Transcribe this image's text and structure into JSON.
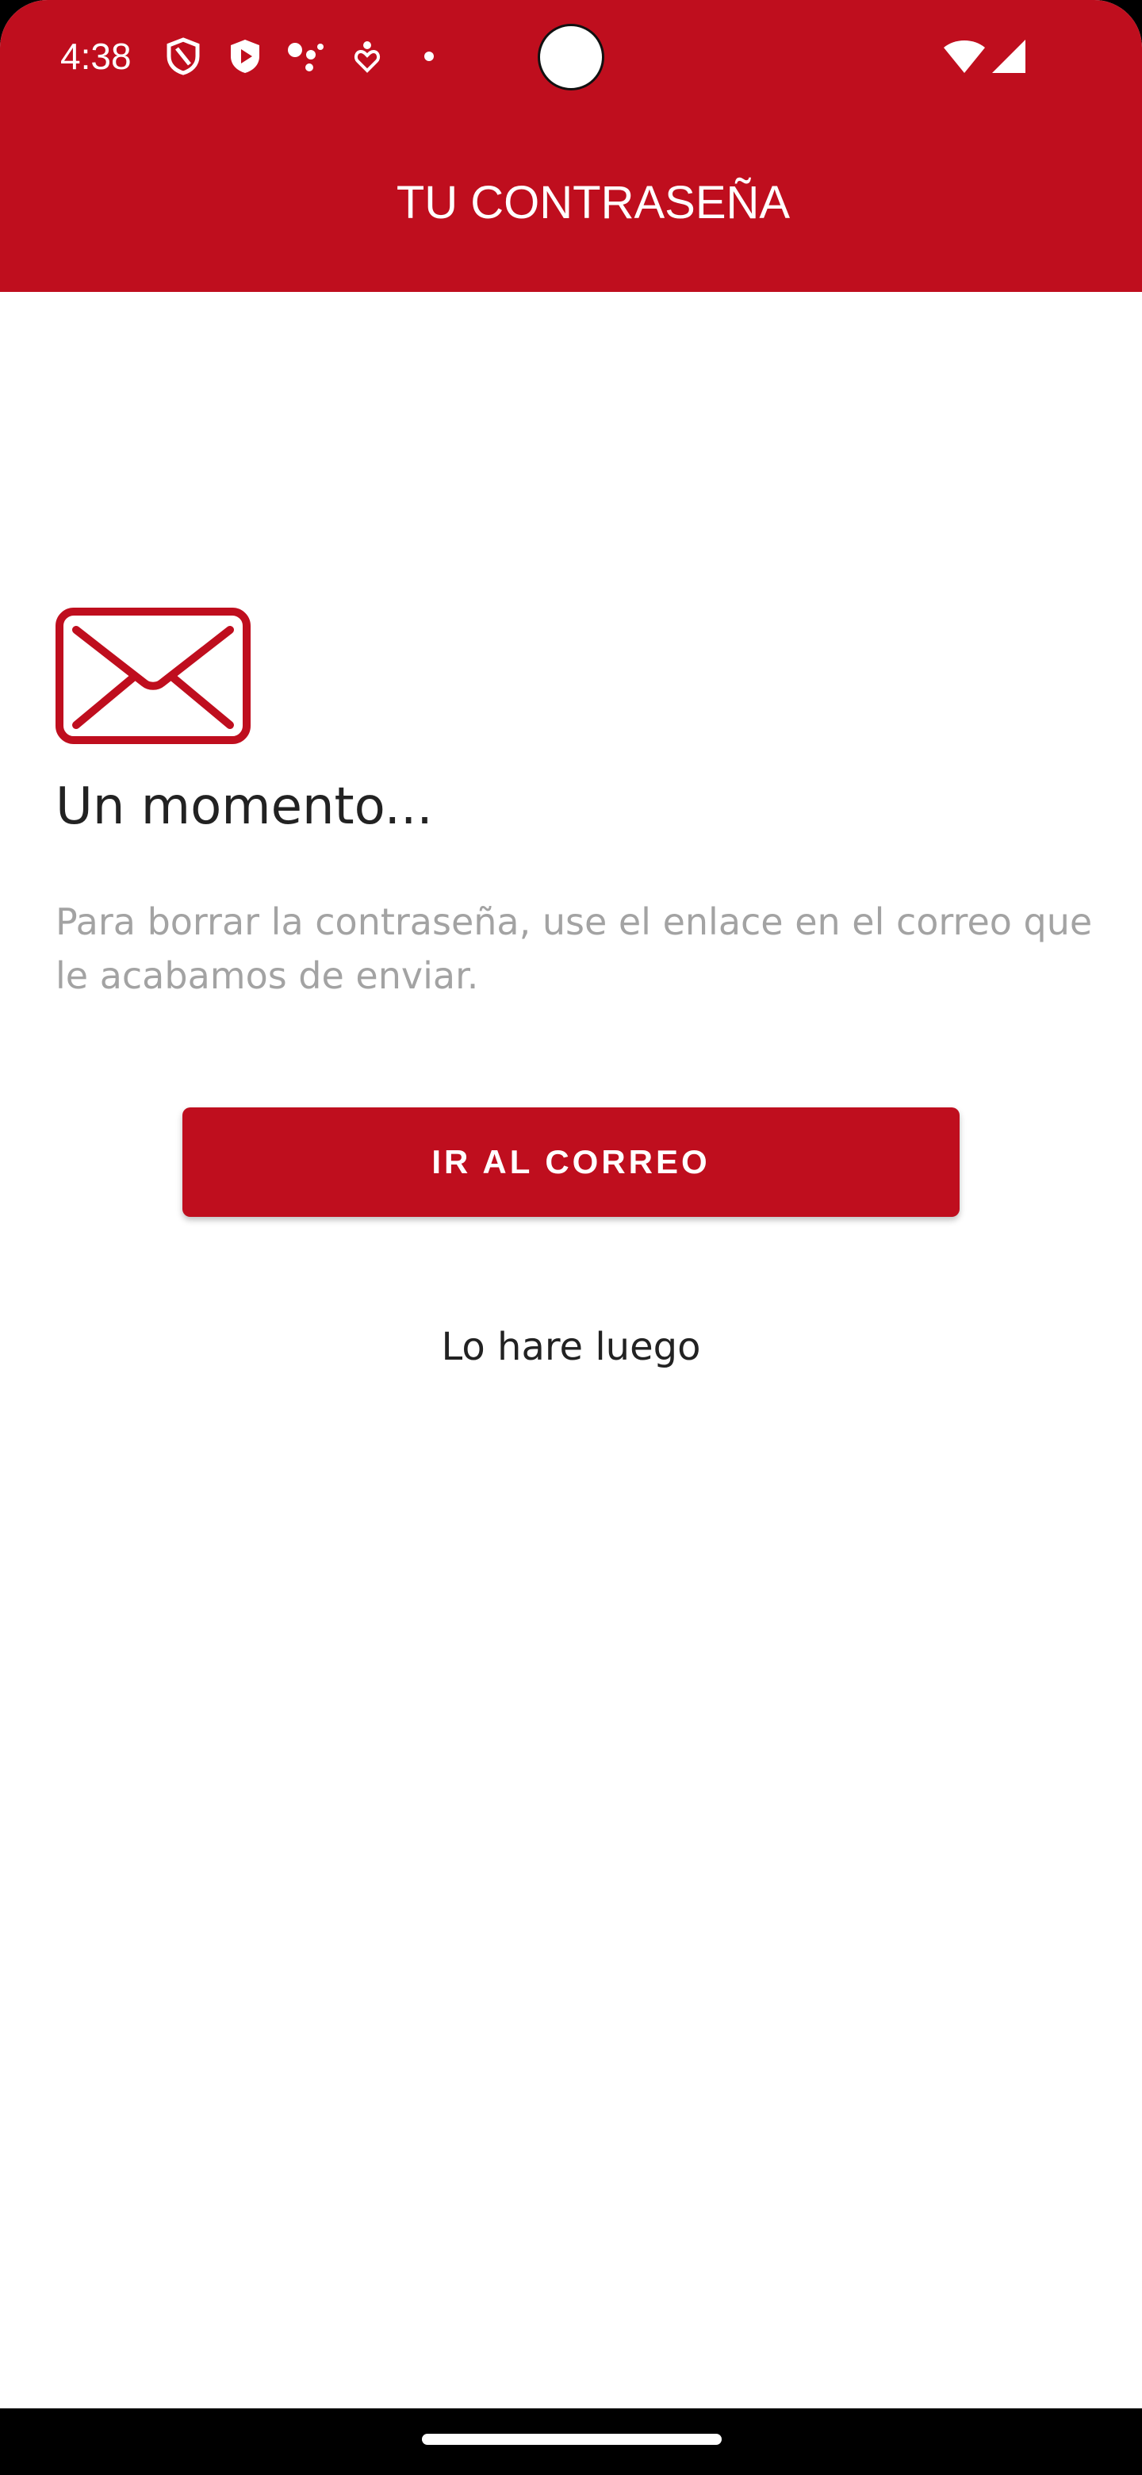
{
  "status_bar": {
    "time": "4:38",
    "icons": [
      "shield-outline-icon",
      "shield-play-icon",
      "dots-cluster-icon",
      "heart-pin-icon",
      "dot-icon",
      "wifi-icon",
      "cellular-signal-icon"
    ]
  },
  "app_bar": {
    "title": "TU CONTRASEÑA"
  },
  "content": {
    "icon": "envelope-icon",
    "heading": "Un momento...",
    "description": "Para borrar la contraseña, use el enlace en el correo que le acabamos de enviar.",
    "primary_button_label": "IR AL CORREO",
    "secondary_link_label": "Lo hare luego"
  },
  "colors": {
    "brand": "#bf0e1e",
    "text": "#222222",
    "muted_text": "#a3a3a3",
    "background": "#ffffff"
  }
}
